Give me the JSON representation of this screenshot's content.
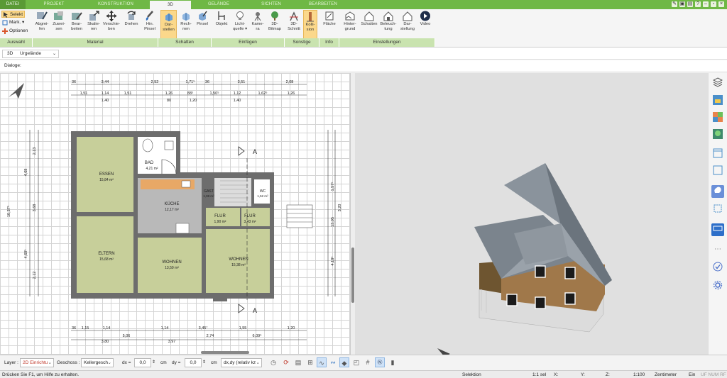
{
  "tabs": {
    "datei": "DATEI",
    "projekt": "PROJEKT",
    "konstruktion": "KONSTRUKTION",
    "drei_d": "3D",
    "gelaende": "GELÄNDE",
    "sichten": "SICHTEN",
    "bearbeiten": "BEARBEITEN"
  },
  "ribbon": {
    "auswahl": {
      "selekt": "Selekt",
      "mark": "Mark.",
      "optionen": "Optionen",
      "group": "Auswahl"
    },
    "material": {
      "group": "Material",
      "buttons": [
        {
          "l1": "Abgrei-",
          "l2": "fen"
        },
        {
          "l1": "Zuwei-",
          "l2": "sen"
        },
        {
          "l1": "Bear-",
          "l2": "beiten"
        },
        {
          "l1": "Skalie-",
          "l2": "ren"
        },
        {
          "l1": "Verschie-",
          "l2": "ben"
        },
        {
          "l1": "Drehen",
          "l2": ""
        },
        {
          "l1": "Hin.",
          "l2": "Pinsel"
        }
      ]
    },
    "schatten": {
      "group": "Schatten",
      "buttons": [
        {
          "l1": "Dar-",
          "l2": "stellen"
        },
        {
          "l1": "Rech-",
          "l2": "nen"
        },
        {
          "l1": "Pinsel",
          "l2": ""
        }
      ]
    },
    "einfuegen": {
      "group": "Einfügen",
      "buttons": [
        {
          "l1": "Objekt",
          "l2": ""
        },
        {
          "l1": "Licht-",
          "l2": "quelle ▾"
        },
        {
          "l1": "Kame-",
          "l2": "ra"
        },
        {
          "l1": "3D-",
          "l2": "Bitmap"
        }
      ]
    },
    "sonstige": {
      "group": "Sonstige",
      "buttons": [
        {
          "l1": "3D-",
          "l2": "Schnitt"
        },
        {
          "l1": "Kolli-",
          "l2": "sion"
        }
      ]
    },
    "info": {
      "group": "Info",
      "buttons": [
        {
          "l1": "Fläche",
          "l2": ""
        }
      ]
    },
    "einstellungen": {
      "group": "Einstellungen",
      "buttons": [
        {
          "l1": "Hinter-",
          "l2": "grund"
        },
        {
          "l1": "Schatten",
          "l2": ""
        },
        {
          "l1": "Beleuch-",
          "l2": "tung"
        },
        {
          "l1": "Dar-",
          "l2": "stellung"
        },
        {
          "l1": "Video",
          "l2": ""
        }
      ]
    }
  },
  "viewbar": {
    "mode": "3D",
    "terrain": "Urgelände"
  },
  "dialog_label": "Dialoge:",
  "plan": {
    "rooms": [
      {
        "name": "ESSEN",
        "area": "15,84 m²"
      },
      {
        "name": "BAD",
        "area": "4,21 m²"
      },
      {
        "name": "KÜCHE",
        "area": "12,17 m²"
      },
      {
        "name": "FLUR",
        "area": "1,90 m²"
      },
      {
        "name": "FLUR",
        "area": "3,43 m²"
      },
      {
        "name": "ELTERN",
        "area": "15,68 m²"
      },
      {
        "name": "WOHNEN",
        "area": "13,59 m²"
      },
      {
        "name": "WOHNEN",
        "area": "15,38 m²"
      },
      {
        "name": "GAST",
        "area": "1,08 m²"
      },
      {
        "name": "WC",
        "area": "1,52 m²"
      }
    ],
    "section_label": "A",
    "dims_top_1": [
      "36",
      "3,44",
      "2,52",
      "1,71⁵",
      "36",
      "3,51",
      "2,08"
    ],
    "dims_top_2": [
      "1,51",
      "1,14",
      "1,51",
      "1,26",
      "88⁵",
      "1,50⁵",
      "1,12",
      "1,62⁵",
      "1,26"
    ],
    "dims_top_2_sub": [
      "1,40",
      "80",
      "1,20",
      "1,40"
    ],
    "dims_bottom_1": [
      "36",
      "1,15",
      "1,14",
      "1,14",
      "3,45⁷",
      "1,55",
      "1,20"
    ],
    "dims_bottom_2": [
      "3,80",
      "5,06",
      "3,97",
      "2,74",
      "6,09⁵"
    ],
    "dims_left": [
      "2,13",
      "4,68",
      "3,68",
      "4,60⁵",
      "2,12",
      "10,37⁵"
    ],
    "dims_right": [
      "1,57⁵",
      "3,20",
      "13,05",
      "4,18⁵"
    ]
  },
  "toolbar": {
    "layer_label": "Layer :",
    "layer_value": "2D Einrichtu",
    "geschoss_label": "Geschoss :",
    "geschoss_value": "Kellergesch",
    "dx_label": "dx =",
    "dx_value": "0,0",
    "dx_unit": "cm",
    "dy_label": "dy =",
    "dy_value": "0,0",
    "dy_unit": "cm",
    "dxdy_value": "dx,dy (relativ kz"
  },
  "status": {
    "help": "Drücken Sie F1, um Hilfe zu erhalten.",
    "mode": "Selektion",
    "sel": "1:1 sel",
    "x": "X:",
    "y": "Y:",
    "z": "Z:",
    "scale": "1:100",
    "unit": "Zentimeter",
    "ein": "Ein",
    "flags": "UF NUM RF"
  },
  "colors": {
    "tab_green": "#6fb845",
    "group_green": "#c9e3af",
    "room_fill": "#c7cf9a",
    "wall": "#6d6d6d",
    "highlight": "#fbd88b"
  }
}
